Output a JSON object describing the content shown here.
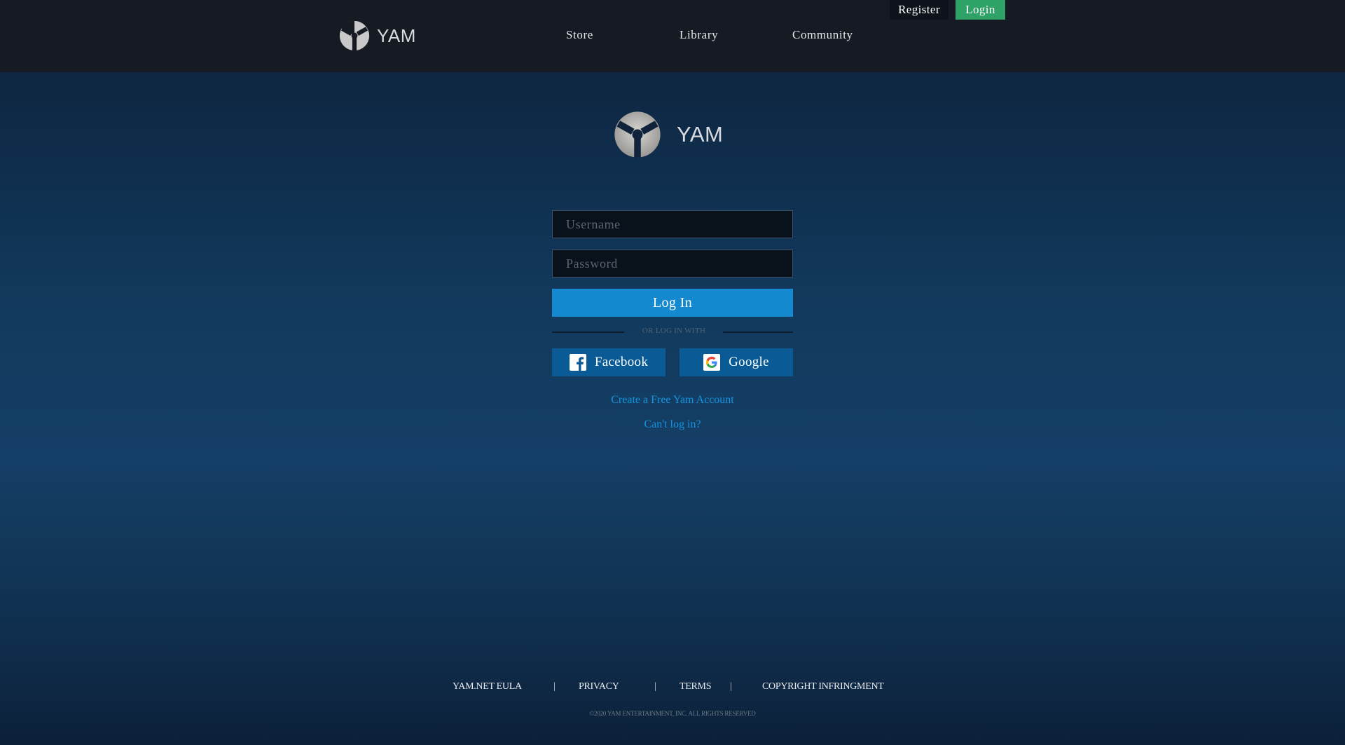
{
  "header": {
    "brand": "YAM",
    "nav": [
      "Store",
      "Library",
      "Community"
    ],
    "register_label": "Register",
    "login_label": "Login"
  },
  "login_panel": {
    "brand": "YAM",
    "username_placeholder": "Username",
    "password_placeholder": "Password",
    "submit_label": "Log In",
    "divider_text": "OR LOG IN WITH",
    "social": [
      {
        "label": "Facebook",
        "icon": "facebook-icon"
      },
      {
        "label": "Google",
        "icon": "google-icon"
      }
    ],
    "create_account_label": "Create a Free Yam Account",
    "cant_login_label": "Can't log in?"
  },
  "footer": {
    "links": [
      "YAM.NET EULA",
      "PRIVACY",
      "TERMS",
      "COPYRIGHT INFRINGMENT"
    ],
    "separator": "|",
    "copyright": "©2020 YAM ENTERTAINMENT, INC. ALL RIGHTS RESERVED"
  },
  "colors": {
    "topbar": "#151a23",
    "login_accent": "#2fa267",
    "primary_button": "#1589d0",
    "social_button": "#0a5a95",
    "link": "#1593e0"
  }
}
